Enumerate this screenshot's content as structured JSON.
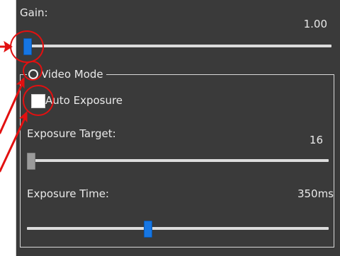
{
  "gain": {
    "label": "Gain:",
    "value": "1.00",
    "level": 0.0
  },
  "video_mode": {
    "label": "Video Mode",
    "selected": false
  },
  "auto_exposure": {
    "label": "Auto Exposure",
    "checked": false
  },
  "exposure_target": {
    "label": "Exposure Target:",
    "value": "16",
    "level": 0.0
  },
  "exposure_time": {
    "label": "Exposure Time:",
    "value": "350ms",
    "level": 0.4
  },
  "colors": {
    "panel": "#3a3a3a",
    "accent": "#1676e3",
    "annotation": "#e21010",
    "text": "#e9e9e9"
  }
}
